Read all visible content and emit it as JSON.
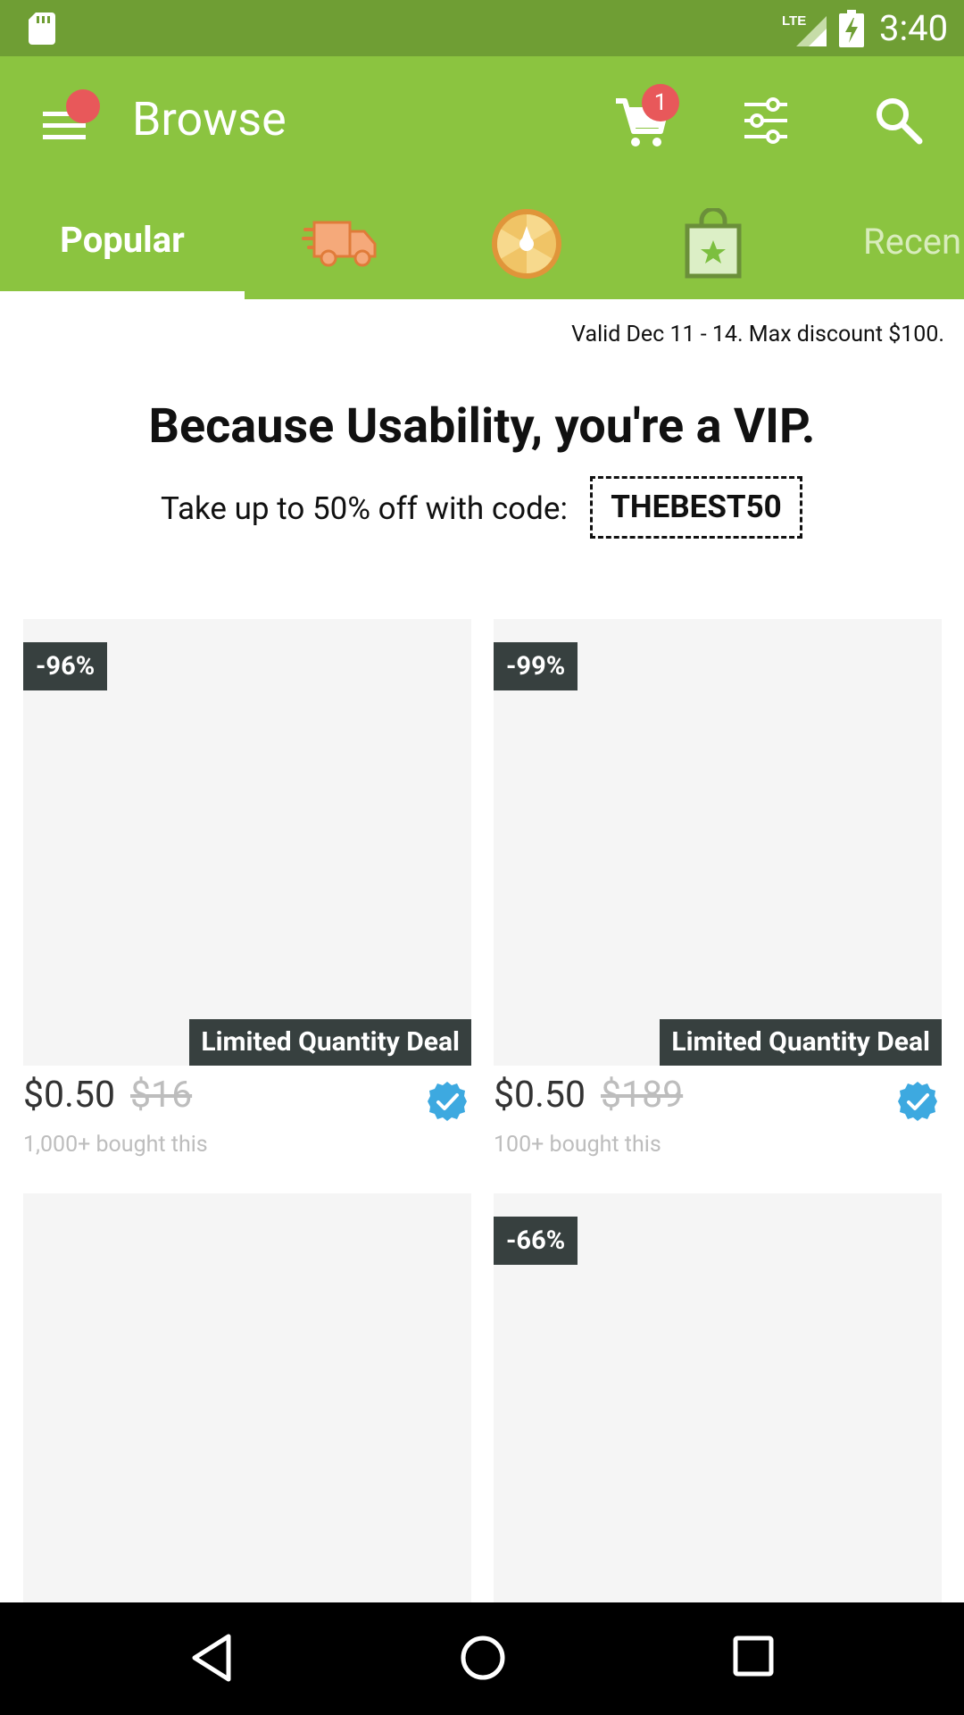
{
  "status_bar": {
    "time": "3:40",
    "network": "LTE",
    "icons": [
      "sd-card-icon",
      "lte-signal-icon",
      "battery-charging-icon"
    ]
  },
  "app_bar": {
    "title": "Browse",
    "cart_count": "1",
    "icons": [
      "menu-icon",
      "cart-icon",
      "filter-icon",
      "search-icon"
    ],
    "colors": {
      "bar": "#8bc440",
      "status": "#6f9e34",
      "badge": "#e8585a"
    }
  },
  "tabs": {
    "popular": "Popular",
    "icon_tabs": [
      "truck-icon",
      "wheel-icon",
      "shopping-bag-icon"
    ],
    "recent": "Recen"
  },
  "promo": {
    "valid": "Valid Dec 11 - 14. Max discount $100.",
    "title": "Because Usability, you're a VIP.",
    "line": "Take up to 50% off with code:",
    "code": "THEBEST50"
  },
  "products": [
    {
      "discount": "-96%",
      "badge": "Limited Quantity Deal",
      "price": "$0.50",
      "old_price": "$16",
      "bought": "1,000+ bought this",
      "verified": true
    },
    {
      "discount": "-99%",
      "badge": "Limited Quantity Deal",
      "price": "$0.50",
      "old_price": "$189",
      "bought": "100+ bought this",
      "verified": true
    },
    {
      "discount": "",
      "badge": "",
      "price": "",
      "old_price": "",
      "bought": "",
      "verified": false
    },
    {
      "discount": "-66%",
      "badge": "",
      "price": "",
      "old_price": "",
      "bought": "",
      "verified": false
    }
  ],
  "nav_bar": {
    "icons": [
      "back-icon",
      "home-icon",
      "recents-icon"
    ]
  }
}
